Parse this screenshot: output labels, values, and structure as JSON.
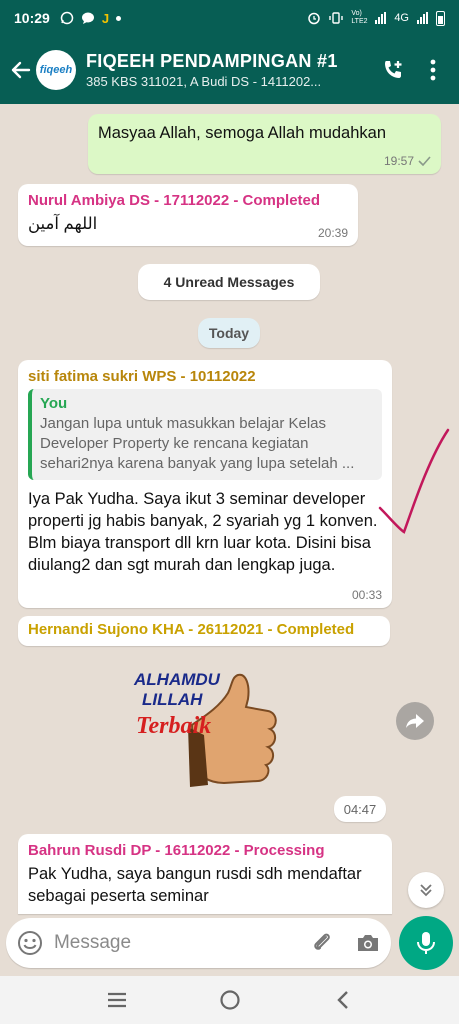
{
  "status_bar": {
    "time": "10:29",
    "network": "4G",
    "lte_label": "Vo) LTE2"
  },
  "header": {
    "avatar_text": "fiqeeh",
    "title": "FIQEEH PENDAMPINGAN #1",
    "subtitle": "385 KBS 311021, A Budi DS - 1411202..."
  },
  "messages": [
    {
      "id": "m1",
      "type": "outgoing",
      "text": "Masyaa Allah, semoga Allah mudahkan",
      "time": "19:57",
      "status": "read"
    },
    {
      "id": "m2",
      "type": "incoming",
      "sender": "Nurul Ambiya DS - 17112022 - Completed",
      "sender_color": "#d63384",
      "text": "اللهم آمين",
      "time": "20:39"
    },
    {
      "id": "m3",
      "type": "incoming",
      "sender": "siti fatima sukri WPS - 10112022",
      "sender_color": "#b8860b",
      "quote_author": "You",
      "quote_text": "Jangan lupa untuk masukkan belajar Kelas Developer Property ke rencana kegiatan sehari2nya karena banyak yang lupa setelah ...",
      "text": "Iya Pak Yudha. Saya ikut 3 seminar developer properti jg habis banyak, 2 syariah yg 1 konven. Blm biaya transport dll krn luar kota. Disini bisa diulang2 dan sgt murah dan lengkap juga.",
      "time": "00:33"
    },
    {
      "id": "m4",
      "type": "incoming-sticker",
      "sender": "Hernandi Sujono KHA - 26112021 - Completed",
      "sender_color": "#c9a100",
      "sticker_line1": "ALHAMDU",
      "sticker_line2": "LILLAH",
      "sticker_line3": "Terbaik",
      "time": "04:47"
    },
    {
      "id": "m5",
      "type": "incoming",
      "sender": "Bahrun Rusdi DP - 16112022 - Processing",
      "sender_color": "#d63384",
      "text": "Pak Yudha, saya bangun rusdi sdh mendaftar sebagai peserta seminar"
    }
  ],
  "unread_label": "4 Unread Messages",
  "date_label": "Today",
  "composer": {
    "placeholder": "Message"
  },
  "colors": {
    "header": "#075e54",
    "accent": "#00a884",
    "outgoing_bubble": "#dcf8c6"
  }
}
